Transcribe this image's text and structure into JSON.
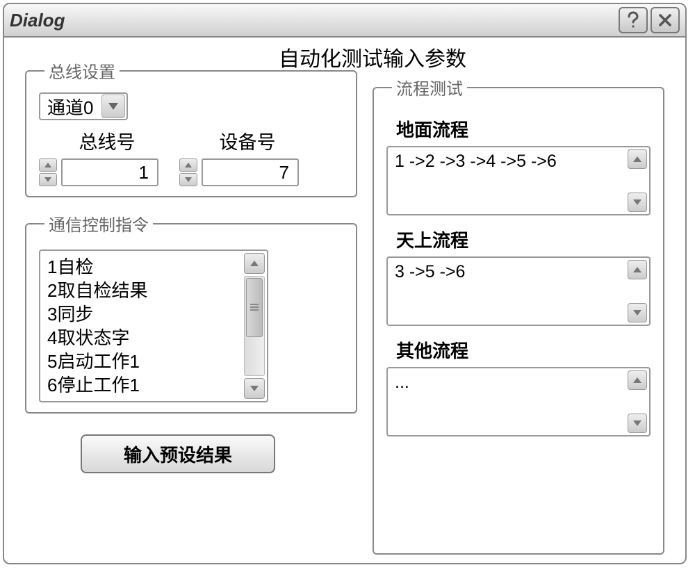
{
  "window": {
    "title": "Dialog"
  },
  "main_title": "自动化测试输入参数",
  "bus_settings": {
    "legend": "总线设置",
    "channel": "通道0",
    "bus_label": "总线号",
    "bus_value": "1",
    "device_label": "设备号",
    "device_value": "7"
  },
  "cmd_group": {
    "legend": "通信控制指令",
    "items": [
      "1自检",
      "2取自检结果",
      "3同步",
      "4取状态字",
      "5启动工作1",
      "6停止工作1"
    ]
  },
  "preset_button": "输入预设结果",
  "flow_test": {
    "legend": "流程测试",
    "ground": {
      "label": "地面流程",
      "text": "1 ->2 ->3 ->4 ->5 ->6"
    },
    "sky": {
      "label": "天上流程",
      "text": "3 ->5 ->6"
    },
    "other": {
      "label": "其他流程",
      "text": "..."
    }
  }
}
